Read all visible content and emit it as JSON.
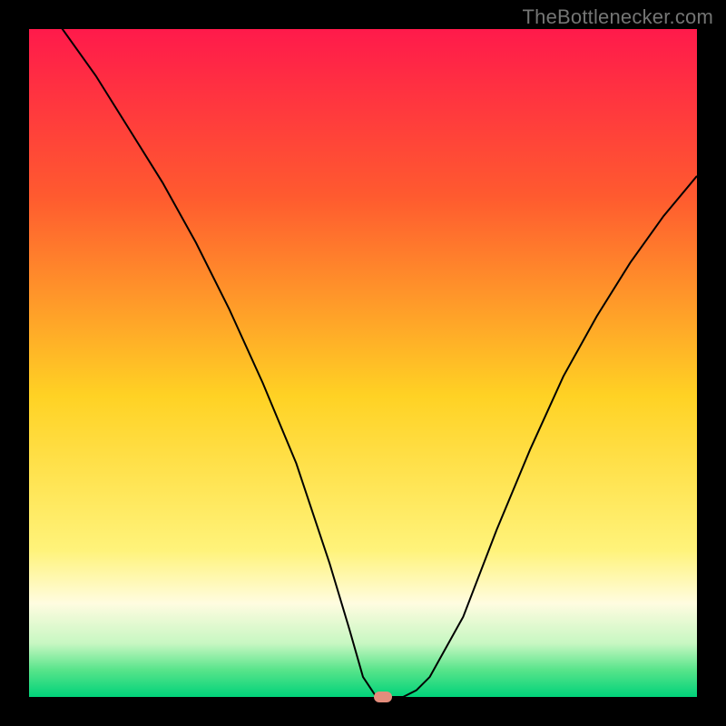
{
  "watermark": {
    "text": "TheBottlenecker.com"
  },
  "chart_data": {
    "type": "line",
    "title": "",
    "xlabel": "",
    "ylabel": "",
    "xlim": [
      0,
      100
    ],
    "ylim": [
      0,
      100
    ],
    "background_gradient": {
      "stops": [
        {
          "pct": 0,
          "color": "#ff1a4b"
        },
        {
          "pct": 25,
          "color": "#ff5a2f"
        },
        {
          "pct": 55,
          "color": "#ffd224"
        },
        {
          "pct": 78,
          "color": "#fff37a"
        },
        {
          "pct": 86,
          "color": "#fffce0"
        },
        {
          "pct": 92,
          "color": "#c7f7c2"
        },
        {
          "pct": 96,
          "color": "#57e48a"
        },
        {
          "pct": 100,
          "color": "#00d27a"
        }
      ]
    },
    "series": [
      {
        "name": "bottleneck-curve",
        "x": [
          0,
          5,
          10,
          15,
          20,
          25,
          30,
          35,
          40,
          45,
          48,
          50,
          52,
          54,
          56,
          58,
          60,
          65,
          70,
          75,
          80,
          85,
          90,
          95,
          100
        ],
        "y": [
          106,
          100,
          93,
          85,
          77,
          68,
          58,
          47,
          35,
          20,
          10,
          3,
          0,
          0,
          0,
          1,
          3,
          12,
          25,
          37,
          48,
          57,
          65,
          72,
          78
        ],
        "stroke": "#000000",
        "stroke_width": 2
      }
    ],
    "curve_min_marker": {
      "x": 53,
      "y": 0,
      "color": "#e48d7c"
    }
  }
}
